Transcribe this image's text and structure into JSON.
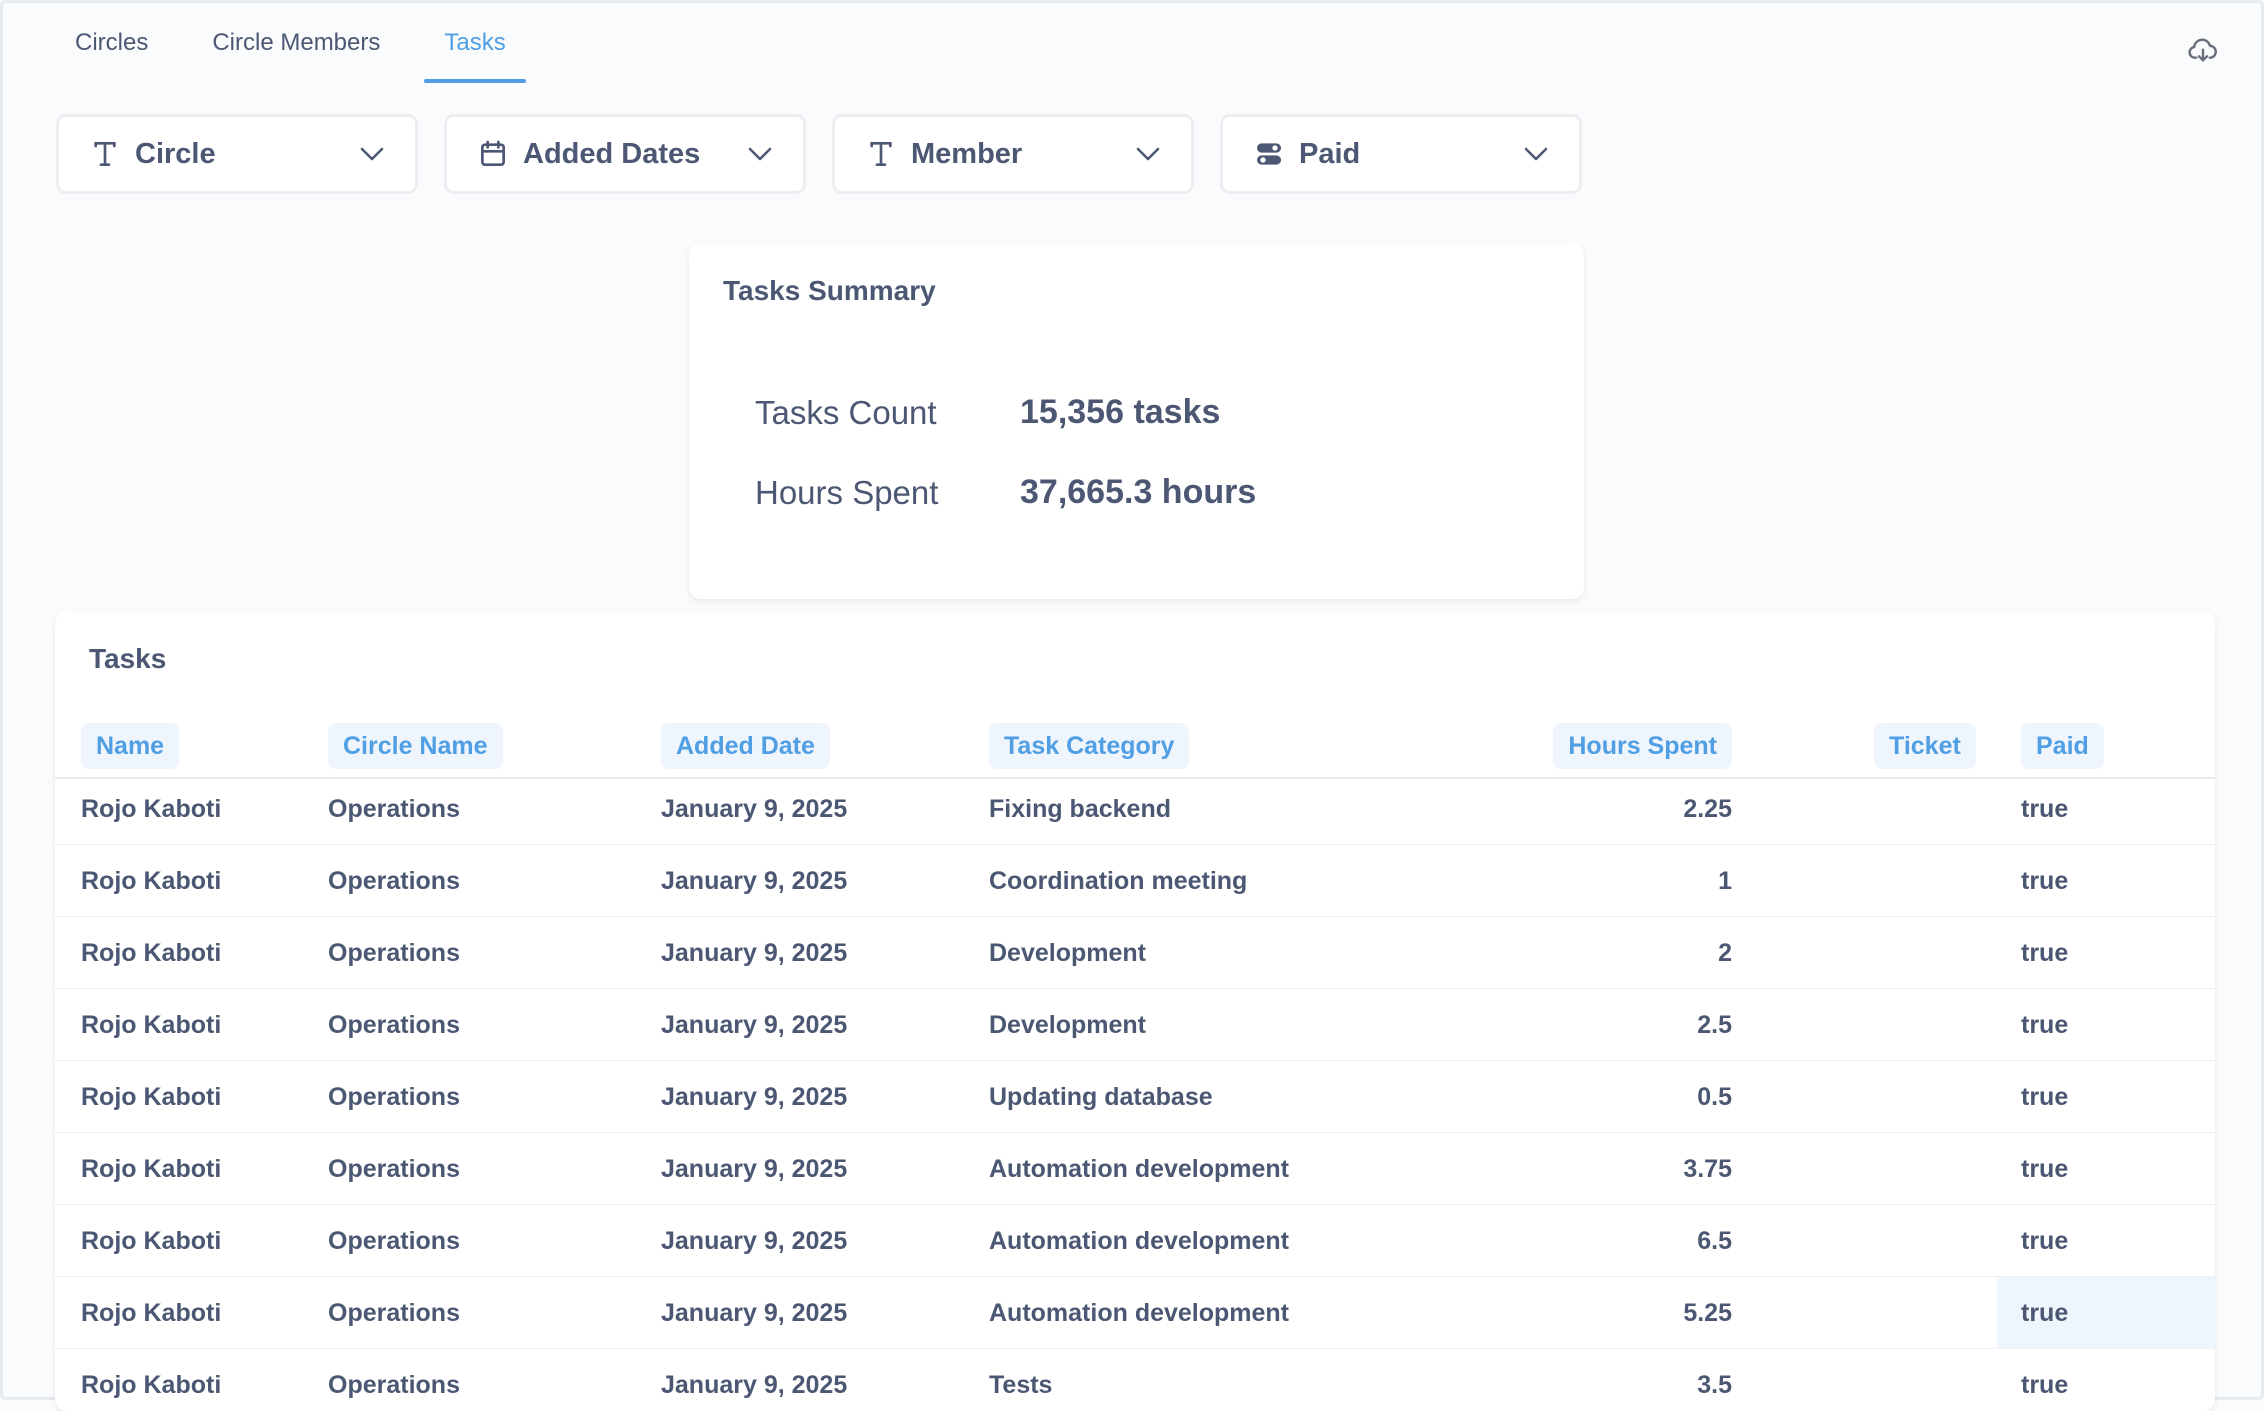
{
  "tabs": [
    {
      "label": "Circles"
    },
    {
      "label": "Circle Members"
    },
    {
      "label": "Tasks"
    }
  ],
  "active_tab": "Tasks",
  "icons": {
    "download": "cloud-download-icon",
    "text": "text-type-icon",
    "calendar": "calendar-icon",
    "toggle": "toggle-icon",
    "chevron": "chevron-down-icon"
  },
  "colors": {
    "accent": "#509ee3",
    "text": "#4c5773",
    "header_bg": "#eef5fc",
    "background": "#f9fbfc"
  },
  "filters": [
    {
      "label": "Circle",
      "icon": "text-type-icon"
    },
    {
      "label": "Added Dates",
      "icon": "calendar-icon"
    },
    {
      "label": "Member",
      "icon": "text-type-icon"
    },
    {
      "label": "Paid",
      "icon": "toggle-icon"
    }
  ],
  "summary": {
    "title": "Tasks Summary",
    "rows": [
      {
        "label": "Tasks Count",
        "value": "15,356 tasks"
      },
      {
        "label": "Hours Spent",
        "value": "37,665.3 hours"
      }
    ]
  },
  "table": {
    "title": "Tasks",
    "columns": [
      "Name",
      "Circle Name",
      "Added Date",
      "Task Category",
      "Hours Spent",
      "Ticket",
      "Paid"
    ],
    "rows": [
      [
        "Rojo Kaboti",
        "Operations",
        "January 9, 2025",
        "Fixing backend",
        "2.25",
        "",
        "true"
      ],
      [
        "Rojo Kaboti",
        "Operations",
        "January 9, 2025",
        "Coordination meeting",
        "1",
        "",
        "true"
      ],
      [
        "Rojo Kaboti",
        "Operations",
        "January 9, 2025",
        "Development",
        "2",
        "",
        "true"
      ],
      [
        "Rojo Kaboti",
        "Operations",
        "January 9, 2025",
        "Development",
        "2.5",
        "",
        "true"
      ],
      [
        "Rojo Kaboti",
        "Operations",
        "January 9, 2025",
        "Updating database",
        "0.5",
        "",
        "true"
      ],
      [
        "Rojo Kaboti",
        "Operations",
        "January 9, 2025",
        "Automation development",
        "3.75",
        "",
        "true"
      ],
      [
        "Rojo Kaboti",
        "Operations",
        "January 9, 2025",
        "Automation development",
        "6.5",
        "",
        "true"
      ],
      [
        "Rojo Kaboti",
        "Operations",
        "January 9, 2025",
        "Automation development",
        "5.25",
        "",
        "true"
      ],
      [
        "Rojo Kaboti",
        "Operations",
        "January 9, 2025",
        "Tests",
        "3.5",
        "",
        "true"
      ]
    ]
  }
}
